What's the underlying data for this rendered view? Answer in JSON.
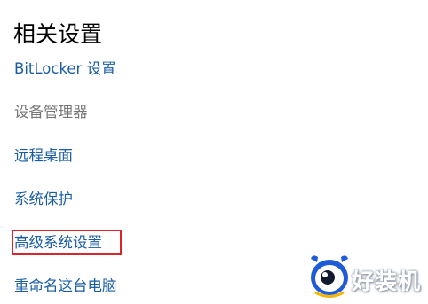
{
  "related_settings": {
    "title": "相关设置",
    "links": {
      "bitlocker": "BitLocker 设置",
      "device_manager": "设备管理器",
      "remote_desktop": "远程桌面",
      "system_protection": "系统保护",
      "advanced_system_settings": "高级系统设置",
      "rename_pc": "重命名这台电脑"
    }
  },
  "highlight_color": "#d9252b",
  "link_color": "#1a5da4",
  "disabled_color": "#767676",
  "watermark": {
    "text": "好装机",
    "icon": "eye-mascot-icon"
  }
}
